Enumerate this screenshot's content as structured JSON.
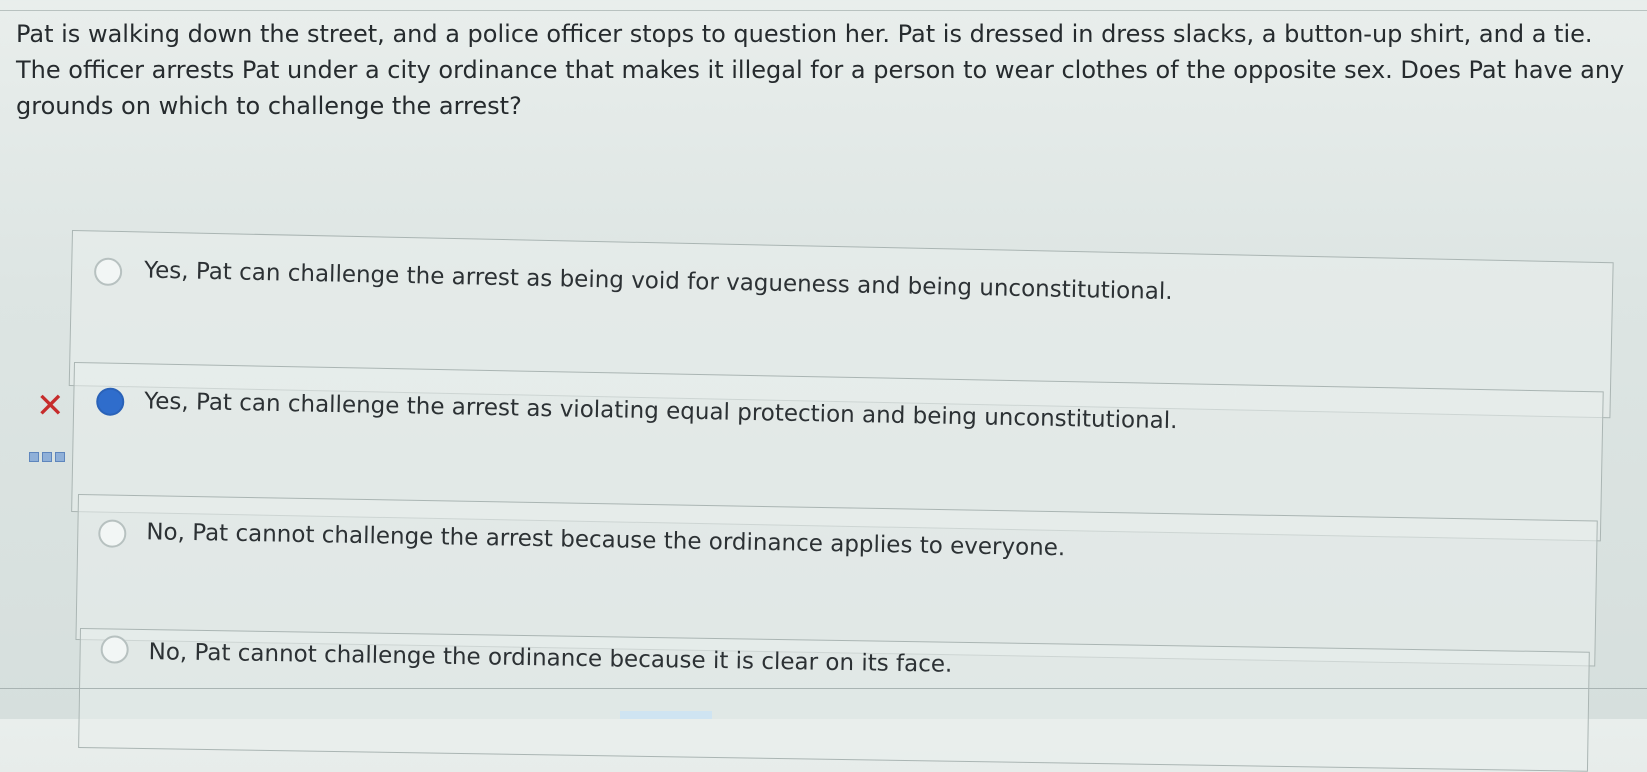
{
  "question": {
    "text": "Pat is walking down the street, and a police officer stops to question her. Pat is dressed in dress slacks, a button-up shirt, and a tie. The officer arrests Pat under a city ordinance that makes it illegal for a person to wear clothes of the opposite sex. Does Pat have any grounds on which to challenge the arrest?"
  },
  "options": [
    {
      "label": "Yes, Pat can challenge the arrest as being void for vagueness and being unconstitutional.",
      "selected": false
    },
    {
      "label": "Yes, Pat can challenge the arrest as violating equal protection and being unconstitutional.",
      "selected": true,
      "marked": "incorrect"
    },
    {
      "label": "No, Pat cannot challenge the arrest because the ordinance applies to everyone.",
      "selected": false
    },
    {
      "label": "No, Pat cannot challenge the ordinance because it is clear on its face.",
      "selected": false
    }
  ],
  "feedback": {
    "wrong_symbol": "✕",
    "more_icon": "ellipsis-icon"
  },
  "colors": {
    "selected_radio": "#2f6dcc",
    "wrong_mark": "#c62c2c"
  }
}
